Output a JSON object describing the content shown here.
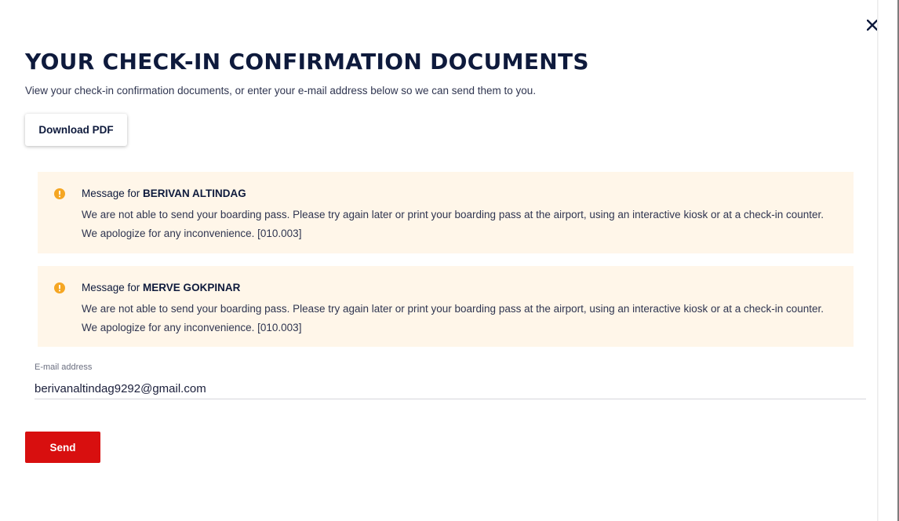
{
  "dialog": {
    "title": "YOUR CHECK-IN CONFIRMATION DOCUMENTS",
    "subtitle": "View your check-in confirmation documents, or enter your e-mail address below so we can send them to you.",
    "close_icon": "close-icon",
    "download_label": "Download PDF"
  },
  "messages": [
    {
      "prefix": "Message for ",
      "name": "BERIVAN ALTINDAG",
      "body": "We are not able to send your boarding pass. Please try again later or print your boarding pass at the airport, using an interactive kiosk or at a check-in counter. We apologize for any inconvenience. [010.003]",
      "icon": "warning-icon",
      "icon_color": "#f5a623"
    },
    {
      "prefix": "Message for ",
      "name": "MERVE GOKPINAR",
      "body": "We are not able to send your boarding pass. Please try again later or print your boarding pass at the airport, using an interactive kiosk or at a check-in counter. We apologize for any inconvenience. [010.003]",
      "icon": "warning-icon",
      "icon_color": "#f5a623"
    }
  ],
  "email": {
    "label": "E-mail address",
    "value": "berivanaltindag9292@gmail.com"
  },
  "send_label": "Send",
  "colors": {
    "primary_red": "#d80f0f",
    "message_bg": "#fff6e9",
    "heading": "#0e1a3c"
  }
}
